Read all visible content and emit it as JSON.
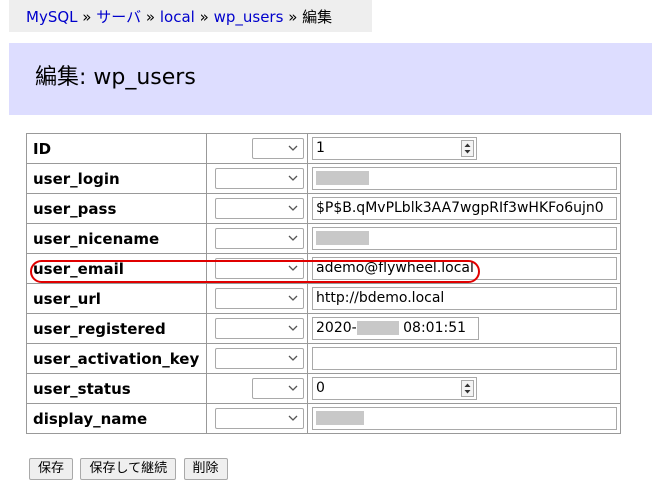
{
  "breadcrumb": {
    "items": [
      "MySQL",
      "サーバ",
      "local",
      "wp_users"
    ],
    "separator": "»",
    "current": "編集"
  },
  "header": {
    "title": "編集: wp_users"
  },
  "fields": [
    {
      "name": "ID",
      "value": "1",
      "type": "number"
    },
    {
      "name": "user_login",
      "value": "",
      "type": "text",
      "redacted": true
    },
    {
      "name": "user_pass",
      "value": "$P$B.qMvPLblk3AA7wgpRIf3wHKFo6ujn0",
      "type": "text"
    },
    {
      "name": "user_nicename",
      "value": "",
      "type": "text",
      "redacted": true
    },
    {
      "name": "user_email",
      "value": "ademo@flywheel.local",
      "type": "text",
      "highlighted": true
    },
    {
      "name": "user_url",
      "value": "http://bdemo.local",
      "type": "text"
    },
    {
      "name": "user_registered",
      "value_prefix": "2020-",
      "value_suffix": "08:01:51",
      "type": "datetime",
      "redacted": true
    },
    {
      "name": "user_activation_key",
      "value": "",
      "type": "text"
    },
    {
      "name": "user_status",
      "value": "0",
      "type": "number"
    },
    {
      "name": "display_name",
      "value": "",
      "type": "text",
      "redacted": true
    }
  ],
  "buttons": {
    "save": "保存",
    "save_continue": "保存して継続",
    "delete": "削除"
  },
  "colors": {
    "link": "#0000cc",
    "header_bg": "#ddddff",
    "breadcrumb_bg": "#eeeeee",
    "highlight": "#e00000"
  }
}
